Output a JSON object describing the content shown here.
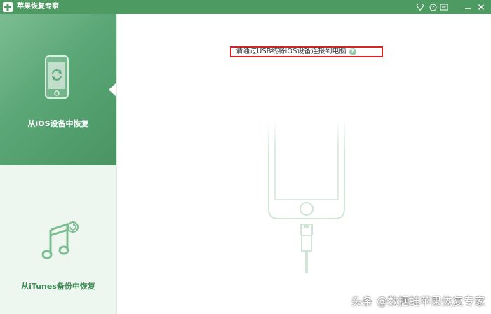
{
  "app": {
    "title": "苹果恢复专家",
    "logo_icon": "apple-plus-icon"
  },
  "window_controls": [
    {
      "name": "vip-diamond-icon",
      "glyph": "◇"
    },
    {
      "name": "help-icon",
      "glyph": "?"
    },
    {
      "name": "message-icon",
      "glyph": "✉"
    },
    {
      "name": "minimize-icon",
      "glyph": "—"
    },
    {
      "name": "close-icon",
      "glyph": "✕"
    }
  ],
  "sidebar": {
    "items": [
      {
        "label": "从iOS设备中恢复",
        "icon": "phone-sync-icon",
        "active": true
      },
      {
        "label": "从iTunes备份中恢复",
        "icon": "music-note-sync-icon",
        "active": false
      }
    ]
  },
  "main": {
    "instruction": "请通过USB线将iOS设备连接到电脑",
    "help_glyph": "?",
    "illustration": "phone-usb-cable-icon"
  },
  "watermark": "头条 @数据蛙苹果恢复专家",
  "colors": {
    "brand_green": "#4e9a63",
    "sidebar_bg": "#eef6f0",
    "highlight_red": "#e02020"
  }
}
